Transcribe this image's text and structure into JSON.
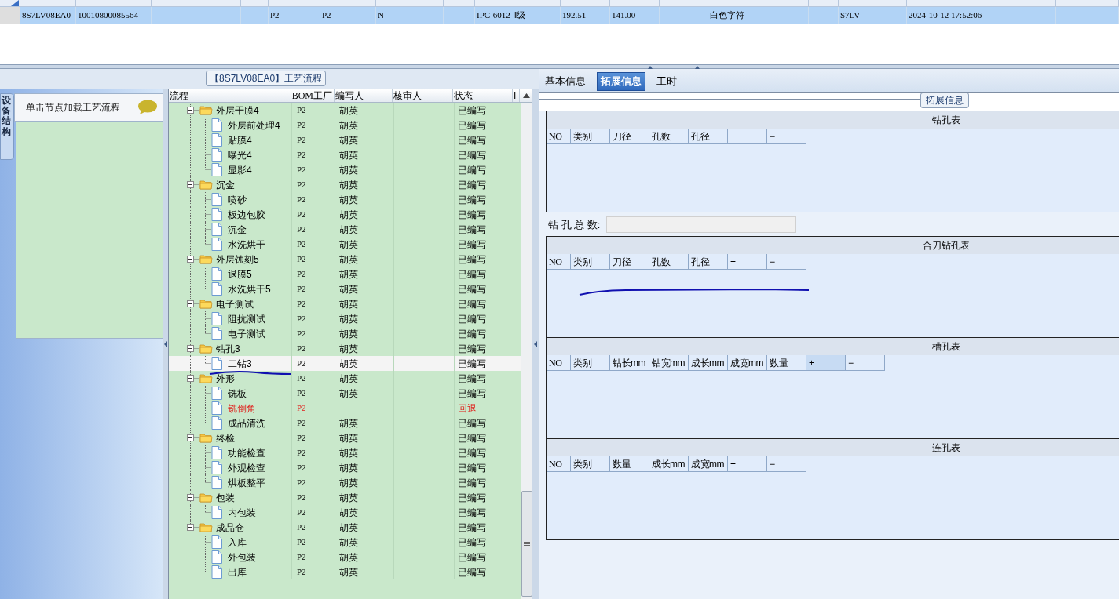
{
  "top_grid": {
    "rows": [
      {
        "selected": true,
        "cells": [
          "8S7LV08EA0",
          "10010800085564",
          "",
          "",
          "P2",
          "P2",
          "N",
          "",
          "",
          "IPC-6012 Ⅱ级",
          "192.51",
          "141.00",
          "",
          "白色字符",
          "",
          "S7LV",
          "2024-10-12 17:52:06",
          "",
          ""
        ]
      }
    ]
  },
  "process_panel": {
    "title": "【8S7LV08EA0】工艺流程",
    "side_tab": "设备结构",
    "hint": "单击节点加载工艺流程",
    "columns": [
      "流程",
      "BOM工厂",
      "编写人",
      "核审人",
      "状态",
      "I"
    ],
    "groups": [
      {
        "name": "外层干膜4",
        "bom": "P2",
        "author": "胡英",
        "status": "已编写",
        "selected": false,
        "returned": false,
        "children": [
          {
            "name": "外层前处理4",
            "bom": "P2",
            "author": "胡英",
            "status": "已编写",
            "selected": false,
            "returned": false
          },
          {
            "name": "贴膜4",
            "bom": "P2",
            "author": "胡英",
            "status": "已编写",
            "selected": false,
            "returned": false
          },
          {
            "name": "曝光4",
            "bom": "P2",
            "author": "胡英",
            "status": "已编写",
            "selected": false,
            "returned": false
          },
          {
            "name": "显影4",
            "bom": "P2",
            "author": "胡英",
            "status": "已编写",
            "selected": false,
            "returned": false
          }
        ]
      },
      {
        "name": "沉金",
        "bom": "P2",
        "author": "胡英",
        "status": "已编写",
        "selected": false,
        "returned": false,
        "children": [
          {
            "name": "喷砂",
            "bom": "P2",
            "author": "胡英",
            "status": "已编写",
            "selected": false,
            "returned": false
          },
          {
            "name": "板边包胶",
            "bom": "P2",
            "author": "胡英",
            "status": "已编写",
            "selected": false,
            "returned": false
          },
          {
            "name": "沉金",
            "bom": "P2",
            "author": "胡英",
            "status": "已编写",
            "selected": false,
            "returned": false
          },
          {
            "name": "水洗烘干",
            "bom": "P2",
            "author": "胡英",
            "status": "已编写",
            "selected": false,
            "returned": false
          }
        ]
      },
      {
        "name": "外层蚀刻5",
        "bom": "P2",
        "author": "胡英",
        "status": "已编写",
        "selected": false,
        "returned": false,
        "children": [
          {
            "name": "退膜5",
            "bom": "P2",
            "author": "胡英",
            "status": "已编写",
            "selected": false,
            "returned": false
          },
          {
            "name": "水洗烘干5",
            "bom": "P2",
            "author": "胡英",
            "status": "已编写",
            "selected": false,
            "returned": false
          }
        ]
      },
      {
        "name": "电子测试",
        "bom": "P2",
        "author": "胡英",
        "status": "已编写",
        "selected": false,
        "returned": false,
        "children": [
          {
            "name": "阻抗测试",
            "bom": "P2",
            "author": "胡英",
            "status": "已编写",
            "selected": false,
            "returned": false
          },
          {
            "name": "电子测试",
            "bom": "P2",
            "author": "胡英",
            "status": "已编写",
            "selected": false,
            "returned": false
          }
        ]
      },
      {
        "name": "钻孔3",
        "bom": "P2",
        "author": "胡英",
        "status": "已编写",
        "selected": false,
        "returned": false,
        "children": [
          {
            "name": "二钻3",
            "bom": "P2",
            "author": "胡英",
            "status": "已编写",
            "selected": true,
            "returned": false
          }
        ]
      },
      {
        "name": "外形",
        "bom": "P2",
        "author": "胡英",
        "status": "已编写",
        "selected": false,
        "returned": false,
        "children": [
          {
            "name": "铣板",
            "bom": "P2",
            "author": "胡英",
            "status": "已编写",
            "selected": false,
            "returned": false
          },
          {
            "name": "铣倒角",
            "bom": "P2",
            "status": "回退",
            "selected": false,
            "returned": true
          },
          {
            "name": "成品清洗",
            "bom": "P2",
            "author": "胡英",
            "status": "已编写",
            "selected": false,
            "returned": false
          }
        ]
      },
      {
        "name": "终检",
        "bom": "P2",
        "author": "胡英",
        "status": "已编写",
        "selected": false,
        "returned": false,
        "children": [
          {
            "name": "功能检查",
            "bom": "P2",
            "author": "胡英",
            "status": "已编写",
            "selected": false,
            "returned": false
          },
          {
            "name": "外观检查",
            "bom": "P2",
            "author": "胡英",
            "status": "已编写",
            "selected": false,
            "returned": false
          },
          {
            "name": "烘板整平",
            "bom": "P2",
            "author": "胡英",
            "status": "已编写",
            "selected": false,
            "returned": false
          }
        ]
      },
      {
        "name": "包装",
        "bom": "P2",
        "author": "胡英",
        "status": "已编写",
        "selected": false,
        "returned": false,
        "children": [
          {
            "name": "内包装",
            "bom": "P2",
            "author": "胡英",
            "status": "已编写",
            "selected": false,
            "returned": false
          }
        ]
      },
      {
        "name": "成品仓",
        "bom": "P2",
        "author": "胡英",
        "status": "已编写",
        "selected": false,
        "returned": false,
        "children": [
          {
            "name": "入库",
            "bom": "P2",
            "author": "胡英",
            "status": "已编写",
            "selected": false,
            "returned": false
          },
          {
            "name": "外包装",
            "bom": "P2",
            "author": "胡英",
            "status": "已编写",
            "selected": false,
            "returned": false
          },
          {
            "name": "出库",
            "bom": "P2",
            "author": "胡英",
            "status": "已编写",
            "selected": false,
            "returned": false
          }
        ]
      }
    ]
  },
  "detail_panel": {
    "tabs": [
      {
        "label": "基本信息",
        "selected": false
      },
      {
        "label": "拓展信息",
        "selected": true
      },
      {
        "label": "工时",
        "selected": false
      }
    ],
    "group_title": "拓展信息",
    "sections": [
      {
        "kind": "table",
        "title": "钻孔表",
        "columns": [
          {
            "label": "NO",
            "highlighted": false
          },
          {
            "label": "类别",
            "highlighted": false
          },
          {
            "label": "刀径",
            "highlighted": false
          },
          {
            "label": "孔数",
            "highlighted": false
          },
          {
            "label": "孔径",
            "highlighted": false
          },
          {
            "label": "+",
            "highlighted": false
          },
          {
            "label": "−",
            "highlighted": false
          }
        ]
      },
      {
        "kind": "total",
        "label": "钻 孔 总 数:"
      },
      {
        "kind": "table",
        "title": "合刀钻孔表",
        "columns": [
          {
            "label": "NO",
            "highlighted": false
          },
          {
            "label": "类别",
            "highlighted": false
          },
          {
            "label": "刀径",
            "highlighted": false
          },
          {
            "label": "孔数",
            "highlighted": false
          },
          {
            "label": "孔径",
            "highlighted": false
          },
          {
            "label": "+",
            "highlighted": false
          },
          {
            "label": "−",
            "highlighted": false
          }
        ]
      },
      {
        "kind": "table",
        "title": "槽孔表",
        "columns": [
          {
            "label": "NO",
            "highlighted": false
          },
          {
            "label": "类别",
            "highlighted": false
          },
          {
            "label": "钻长mm",
            "highlighted": false
          },
          {
            "label": "钻宽mm",
            "highlighted": false
          },
          {
            "label": "成长mm",
            "highlighted": false
          },
          {
            "label": "成宽mm",
            "highlighted": false
          },
          {
            "label": "数量",
            "highlighted": false
          },
          {
            "label": "+",
            "highlighted": true
          },
          {
            "label": "−",
            "highlighted": false
          }
        ]
      },
      {
        "kind": "table",
        "title": "连孔表",
        "columns": [
          {
            "label": "NO",
            "highlighted": false
          },
          {
            "label": "类别",
            "highlighted": false
          },
          {
            "label": "数量",
            "highlighted": false
          },
          {
            "label": "成长mm",
            "highlighted": false
          },
          {
            "label": "成宽mm",
            "highlighted": false
          },
          {
            "label": "+",
            "highlighted": false
          },
          {
            "label": "−",
            "highlighted": false
          }
        ]
      }
    ]
  }
}
